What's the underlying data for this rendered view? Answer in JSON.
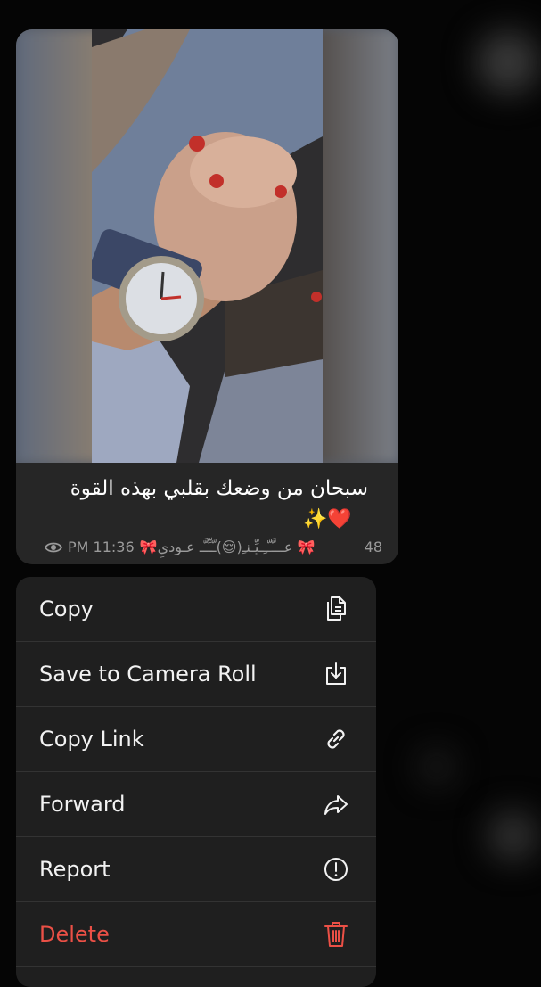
{
  "message": {
    "caption": "سبحان من وضعك بقلبي بهذه القوة",
    "caption_emojis": "✨❤️",
    "views": "48",
    "author": "🎀عـــَّـّـِـيِّـنـِ(😌)ـّـِّـَّـ عـوديِ 🎀",
    "time": "PM 11:36"
  },
  "menu": {
    "items": [
      {
        "label": "Copy",
        "icon": "copy-icon"
      },
      {
        "label": "Save to Camera Roll",
        "icon": "save-icon"
      },
      {
        "label": "Copy Link",
        "icon": "link-icon"
      },
      {
        "label": "Forward",
        "icon": "forward-icon"
      },
      {
        "label": "Report",
        "icon": "report-icon"
      },
      {
        "label": "Delete",
        "icon": "trash-icon"
      }
    ]
  },
  "colors": {
    "background": "#050505",
    "bubble": "#262626",
    "menu": "#1f1f1f",
    "danger": "#eb5046",
    "meta_text": "#9a9a9a"
  }
}
